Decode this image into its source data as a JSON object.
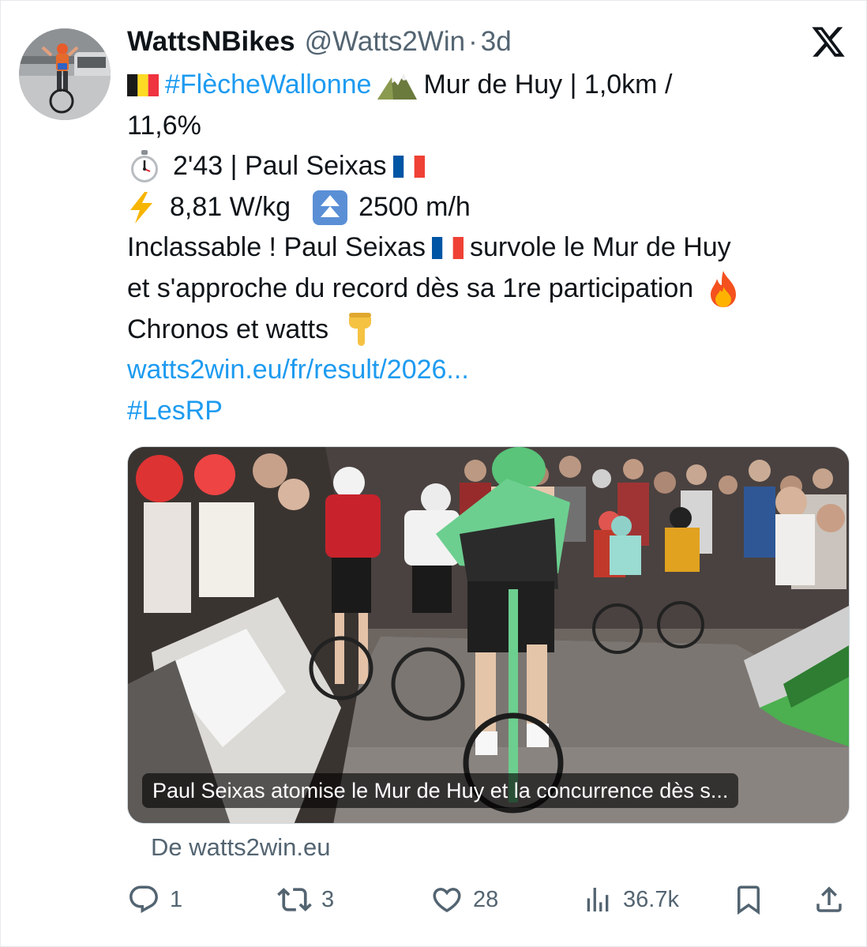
{
  "tweet": {
    "display_name": "WattsNBikes",
    "handle": "@Watts2Win",
    "separator": "·",
    "time": "3d",
    "line1": {
      "hashtag": "#FlècheWallonne",
      "text": "Mur de Huy | 1,0km /"
    },
    "line2": "11,6%",
    "line3": {
      "text": "2'43 | Paul Seixas"
    },
    "line4": {
      "power": "8,81 W/kg",
      "vam": "2500 m/h"
    },
    "line5": {
      "before_flag": "Inclassable ! Paul Seixas",
      "after_flag": "survole le Mur de Huy"
    },
    "line6": "et s'approche du record dès sa 1re participation",
    "line7": "Chronos et watts",
    "link": "watts2win.eu/fr/result/2026...",
    "hashtag2": "#LesRP",
    "icons": {
      "flag_belgium": "belgium-flag-icon",
      "mountain": "mountain-icon",
      "stopwatch": "stopwatch-icon",
      "flag_france": "france-flag-icon",
      "lightning": "lightning-icon",
      "up_arrow": "double-up-arrow-icon",
      "fire": "fire-icon",
      "pointing_down": "pointing-down-hand-icon"
    }
  },
  "media": {
    "caption": "Paul Seixas atomise le Mur de Huy et la concurrence dès s..."
  },
  "source": "De watts2win.eu",
  "actions": {
    "replies": "1",
    "reposts": "3",
    "likes": "28",
    "views": "36.7k"
  },
  "colors": {
    "link": "#1d9bf0",
    "secondary_text": "#536471",
    "text": "#0f1419"
  }
}
